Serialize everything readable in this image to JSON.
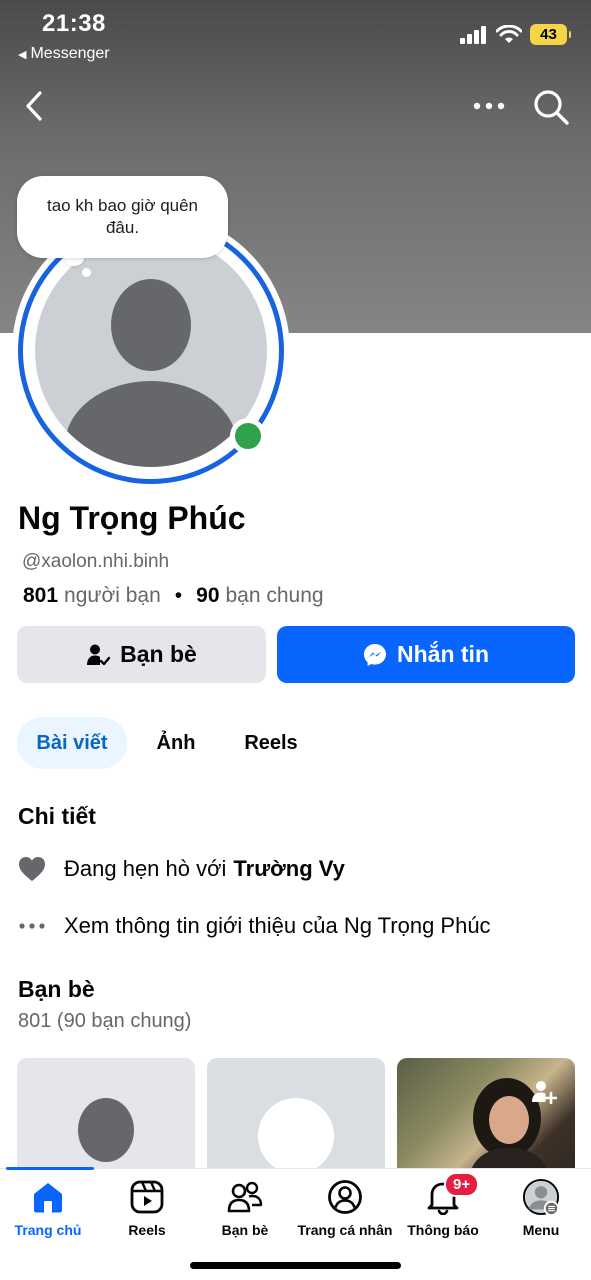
{
  "status_bar": {
    "time": "21:38",
    "back_app": "Messenger",
    "battery": "43",
    "icons": [
      "signal-icon",
      "wifi-icon",
      "battery-icon"
    ]
  },
  "top_nav": {
    "icons": [
      "back-chevron-icon",
      "more-icon",
      "search-icon"
    ]
  },
  "note": {
    "text": "tao kh bao giờ quên đâu."
  },
  "profile": {
    "name": "Ng Trọng Phúc",
    "username": "@xaolon.nhi.binh",
    "friends_count": "801",
    "friends_label": "người bạn",
    "mutual_count": "90",
    "mutual_label": "bạn chung",
    "separator": "•"
  },
  "actions": {
    "friends_button": "Bạn bè",
    "message_button": "Nhắn tin"
  },
  "tabs": [
    {
      "label": "Bài viết",
      "active": true
    },
    {
      "label": "Ảnh",
      "active": false
    },
    {
      "label": "Reels",
      "active": false
    }
  ],
  "details": {
    "title": "Chi tiết",
    "relationship_prefix": "Đang hẹn hò với",
    "relationship_partner": "Trường Vy",
    "about_link": "Xem thông tin giới thiệu của Ng Trọng Phúc"
  },
  "friends_section": {
    "title": "Bạn bè",
    "subtitle": "801 (90 bạn chung)"
  },
  "bottom_nav": [
    {
      "label": "Trang chủ",
      "icon": "home-icon",
      "active": true
    },
    {
      "label": "Reels",
      "icon": "reels-icon",
      "active": false
    },
    {
      "label": "Bạn bè",
      "icon": "friends-icon",
      "active": false
    },
    {
      "label": "Trang cá nhân",
      "icon": "profile-icon",
      "active": false
    },
    {
      "label": "Thông báo",
      "icon": "bell-icon",
      "active": false,
      "badge": "9+"
    },
    {
      "label": "Menu",
      "icon": "menu-avatar-icon",
      "active": false
    }
  ],
  "colors": {
    "accent": "#0866ff",
    "online": "#31a24c",
    "badge": "#e41e3f",
    "battery": "#f5d547"
  }
}
